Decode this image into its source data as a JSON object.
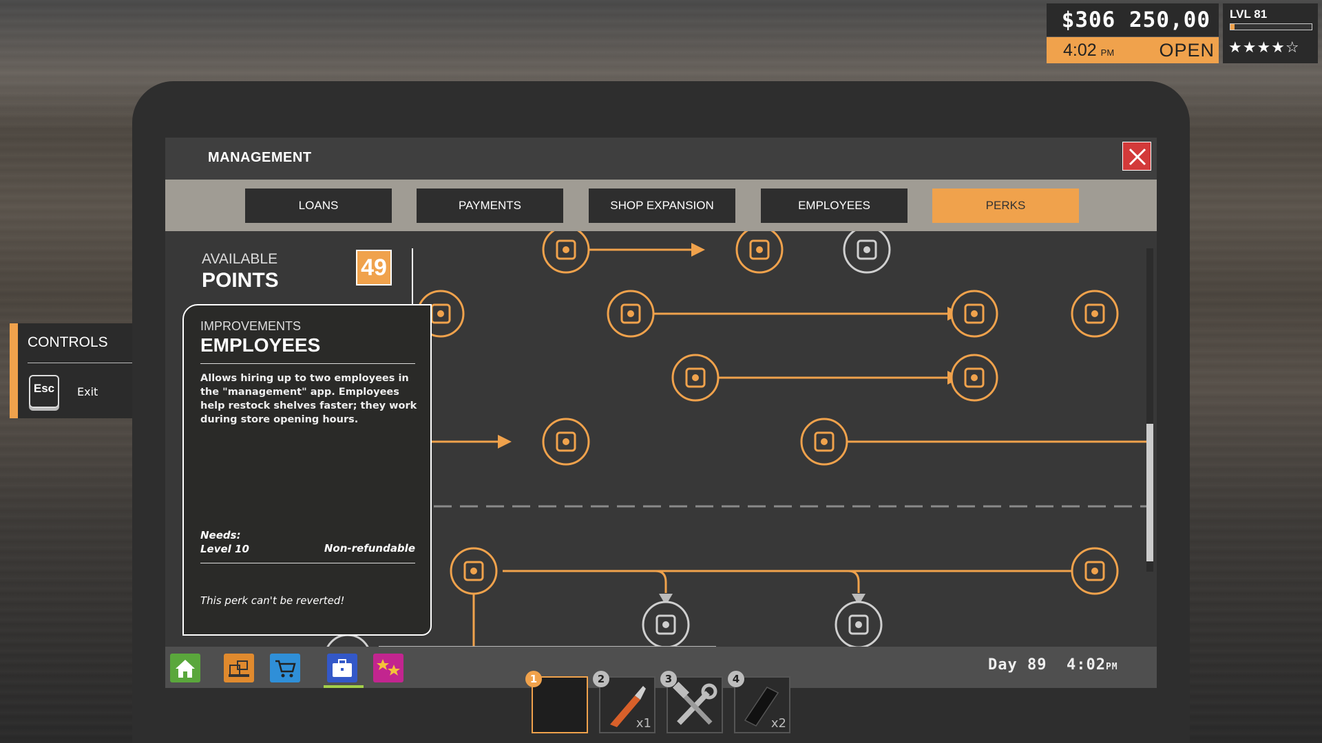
{
  "hud": {
    "money": "$306 250,00",
    "time": "4:02",
    "time_suffix": "PM",
    "shop_status": "OPEN",
    "level": "LVL 81",
    "level_progress": 0.05,
    "stars": "★★★★☆",
    "accent_color": "#f0a24c"
  },
  "controls": {
    "title": "CONTROLS",
    "key": "Esc",
    "action": "Exit"
  },
  "window": {
    "title": "MANAGEMENT",
    "tabs": [
      {
        "label": "LOANS"
      },
      {
        "label": "PAYMENTS"
      },
      {
        "label": "SHOP EXPANSION"
      },
      {
        "label": "EMPLOYEES"
      },
      {
        "label": "PERKS"
      }
    ],
    "active_tab": "PERKS"
  },
  "points": {
    "label": "AVAILABLE",
    "title": "POINTS",
    "value": "49"
  },
  "perk": {
    "category": "IMPROVEMENTS",
    "name": "EMPLOYEES",
    "description": "Allows hiring up to two employees in the \"management\" app. Employees help restock shelves faster; they work during store opening hours.",
    "needs_label": "Needs:",
    "needs_value": "Level 10",
    "refund": "Non-refundable",
    "revert_note": "This perk can't be reverted!"
  },
  "perk_tree": {
    "nodes": [
      {
        "icon": "invoice-register-icon"
      },
      {
        "icon": "discount-hand-icon"
      },
      {
        "icon": "auction-gavel-icon"
      },
      {
        "icon": "hammer-tools-icon"
      },
      {
        "icon": "shopping-basket-icon"
      },
      {
        "icon": "delivery-box-icon"
      },
      {
        "icon": "fast-delivery-icon"
      },
      {
        "icon": "cashier-icon"
      },
      {
        "icon": "fast-shelf-icon"
      },
      {
        "icon": "shelf-stock-icon"
      },
      {
        "icon": "employee-carry-icon"
      },
      {
        "icon": "wrench-hammer-icon"
      },
      {
        "icon": "recycle-gear-icon"
      },
      {
        "icon": "gears-icon"
      },
      {
        "icon": "gear-tools-icon"
      },
      {
        "icon": "small-gear-icon"
      }
    ]
  },
  "taskbar": {
    "apps": [
      {
        "icon": "home-icon",
        "color": "#5aa73c"
      },
      {
        "icon": "boxes-icon",
        "color": "#e08a2e"
      },
      {
        "icon": "cart-icon",
        "color": "#2f8fd8"
      },
      {
        "icon": "briefcase-icon",
        "color": "#3358c8"
      },
      {
        "icon": "stars-icon",
        "color": "#c2258f"
      }
    ],
    "active_app": "briefcase-icon",
    "day": "Day 89",
    "time": "4:02",
    "time_suffix": "PM"
  },
  "hotbar": {
    "slots": [
      {
        "number": "1",
        "item": "",
        "qty": ""
      },
      {
        "number": "2",
        "item": "box-cutter-icon",
        "qty": "x1"
      },
      {
        "number": "3",
        "item": "repair-tools-icon",
        "qty": ""
      },
      {
        "number": "4",
        "item": "shelf-board-icon",
        "qty": "x2"
      }
    ],
    "selected": "1"
  }
}
